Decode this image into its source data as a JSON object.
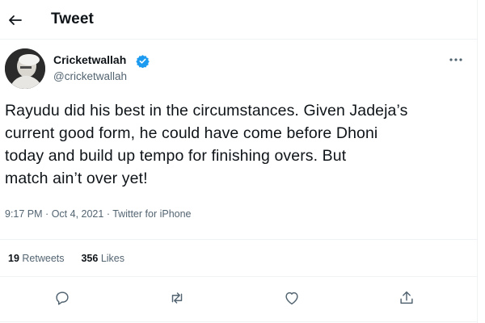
{
  "header": {
    "title": "Tweet",
    "back_icon": "back-arrow-icon"
  },
  "author": {
    "display_name": "Cricketwallah",
    "handle": "@cricketwallah",
    "verified": true
  },
  "tweet": {
    "lines": [
      "Rayudu did his best in the circumstances. Given Jadeja’s",
      "current good form, he could have come before Dhoni",
      "today and build up tempo for finishing overs. But",
      "match ain’t over yet!"
    ],
    "time": "9:17 PM",
    "date": "Oct 4, 2021",
    "source": "Twitter for iPhone",
    "separator": "·"
  },
  "stats": {
    "retweets_count": "19",
    "retweets_label": "Retweets",
    "likes_count": "356",
    "likes_label": "Likes"
  },
  "actions": [
    "reply-icon",
    "retweet-icon",
    "like-icon",
    "share-icon"
  ],
  "colors": {
    "text": "#0f1419",
    "secondary": "#536471",
    "verified": "#1d9bf0",
    "divider": "#eff3f4"
  }
}
